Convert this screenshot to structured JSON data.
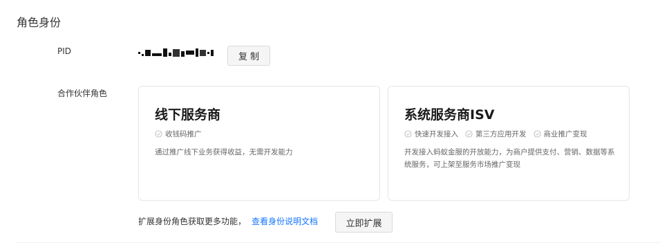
{
  "section": {
    "title": "角色身份"
  },
  "pid": {
    "label": "PID",
    "copy_label": "复制"
  },
  "roles": {
    "label": "合作伙伴角色",
    "cards": [
      {
        "title": "线下服务商",
        "tags": [
          "收钱码推广"
        ],
        "description": "通过推广线下业务获得收益，无需开发能力"
      },
      {
        "title": "系统服务商ISV",
        "tags": [
          "快速开发接入",
          "第三方应用开发",
          "商业推广变现"
        ],
        "description": "开发接入蚂蚁金服的开放能力，为商户提供支付、营销、数据等系统服务，可上架至服务市场推广变现"
      }
    ]
  },
  "footer": {
    "text": "扩展身份角色获取更多功能，",
    "link_label": "查看身份说明文档",
    "expand_label": "立即扩展"
  },
  "colors": {
    "link": "#1677ff",
    "button_bg": "#f5f5f5",
    "card_border": "#e5e5e5"
  }
}
